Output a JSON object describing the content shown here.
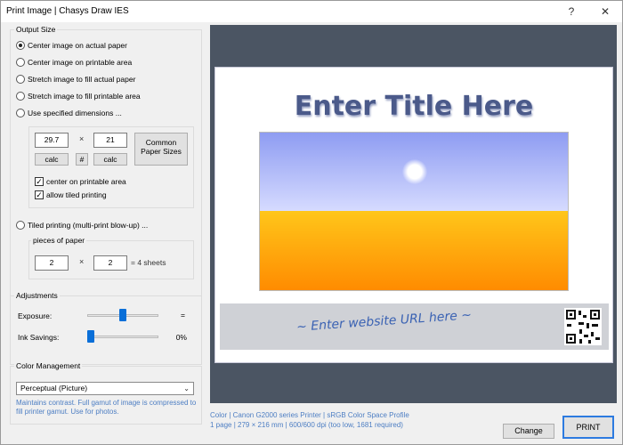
{
  "window": {
    "title": "Print Image | Chasys Draw IES",
    "help_symbol": "?",
    "close_symbol": "✕"
  },
  "output_size": {
    "title": "Output Size",
    "options": [
      {
        "label": "Center image on actual paper",
        "selected": true
      },
      {
        "label": "Center image on printable area",
        "selected": false
      },
      {
        "label": "Stretch image to fill actual paper",
        "selected": false
      },
      {
        "label": "Stretch image to fill printable area",
        "selected": false
      },
      {
        "label": "Use specified dimensions ...",
        "selected": false
      }
    ],
    "width_value": "29.7",
    "height_value": "21",
    "times_symbol": "×",
    "calc_label": "calc",
    "hash_label": "#",
    "common_paper_label": "Common Paper Sizes",
    "center_printable_label": "center on printable area",
    "allow_tiled_label": "allow tiled printing",
    "tiled_option_label": "Tiled printing (multi-print blow-up) ...",
    "pieces_label": "pieces of paper",
    "pieces_x": "2",
    "pieces_y": "2",
    "sheets_label": "= 4 sheets"
  },
  "adjustments": {
    "title": "Adjustments",
    "exposure_label": "Exposure:",
    "exposure_value": "=",
    "exposure_level": 0.5,
    "ink_label": "Ink Savings:",
    "ink_value": "0%",
    "ink_level": 0.0
  },
  "color_management": {
    "title": "Color Management",
    "selected": "Perceptual (Picture)",
    "description": "Maintains contrast. Full gamut of image is compressed to fill printer gamut. Use for photos."
  },
  "preview": {
    "title_text": "Enter Title Here",
    "url_text": "~ Enter website URL here ~"
  },
  "status": {
    "line1": "Color | Canon G2000 series Printer | sRGB Color Space Profile",
    "line2": "1 page | 279 × 216 mm | 600/600 dpi (too low, 1681 required)"
  },
  "buttons": {
    "change": "Change",
    "print": "PRINT"
  },
  "colors": {
    "accent": "#2d7be0",
    "slider": "#0a6fd8",
    "info_text": "#4d7ec3",
    "preview_bg": "#4b5563"
  }
}
